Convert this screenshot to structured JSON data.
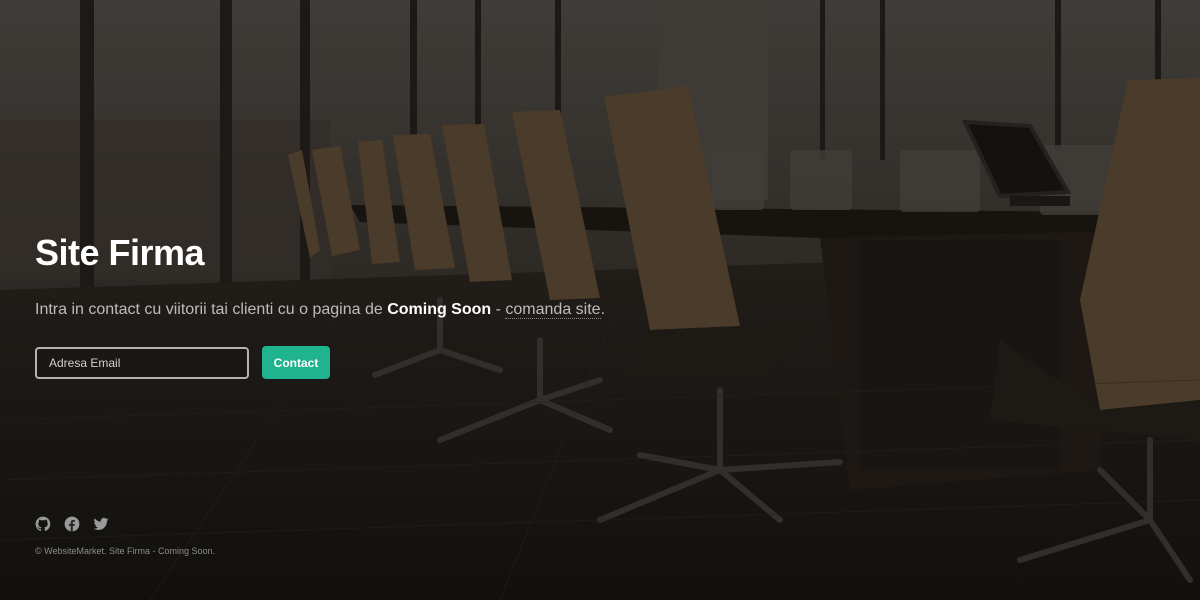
{
  "hero": {
    "title": "Site Firma",
    "subtitle_before": "Intra in contact cu viitorii tai clienti cu o pagina de ",
    "subtitle_strong": "Coming Soon",
    "subtitle_sep": " - ",
    "subtitle_link": "comanda site",
    "subtitle_end": "."
  },
  "form": {
    "email_placeholder": "Adresa Email",
    "submit_label": "Contact"
  },
  "social": {
    "icons": [
      "github-icon",
      "facebook-icon",
      "twitter-icon"
    ]
  },
  "footer": {
    "copyright": "© WebsiteMarket. Site Firma - Coming Soon."
  },
  "colors": {
    "accent": "#1fb38e",
    "title": "#ffffff",
    "subtitle": "#bdbdbd"
  }
}
